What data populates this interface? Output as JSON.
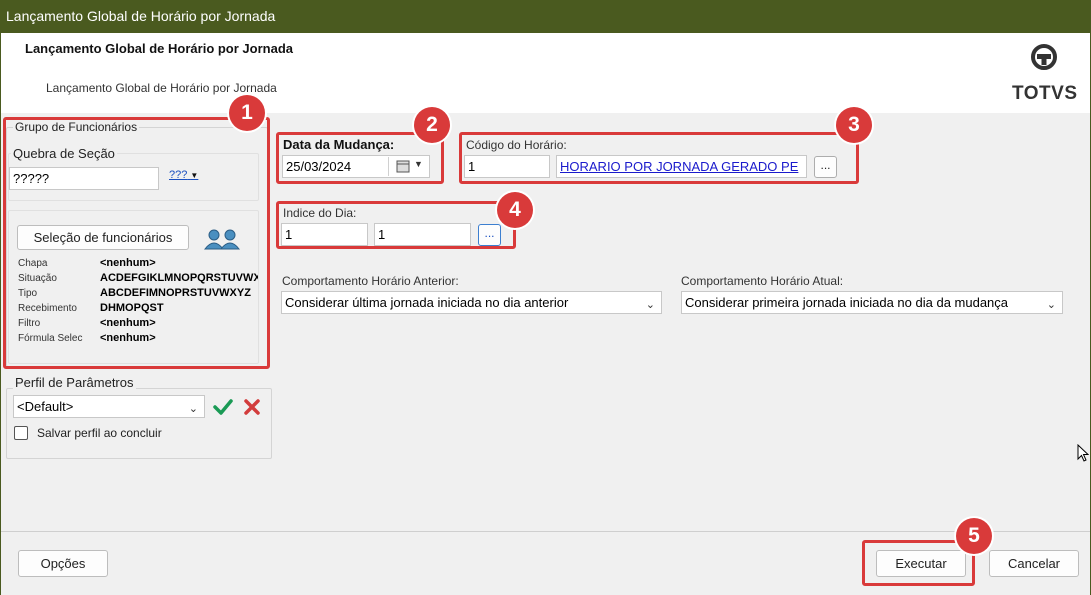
{
  "window": {
    "title": "Lançamento Global de Horário por Jornada"
  },
  "header": {
    "title": "Lançamento Global de Horário por Jornada",
    "subtitle": "Lançamento Global de Horário por Jornada",
    "logo_text": "TOTVS"
  },
  "grupo": {
    "legend": "Grupo de Funcionários",
    "quebra_label": "Quebra de Seção",
    "quebra_value": "?????",
    "quebra_button": "???",
    "selecao_button": "Seleção de funcionários",
    "info": [
      {
        "label": "Chapa",
        "value": "<nenhum>"
      },
      {
        "label": "Situação",
        "value": "ACDEFGIKLMNOPQRSTUVWXYZ"
      },
      {
        "label": "Tipo",
        "value": "ABCDEFIMNOPRSTUVWXYZ"
      },
      {
        "label": "Recebimento",
        "value": "DHMOPQST"
      },
      {
        "label": "Filtro",
        "value": "<nenhum>"
      },
      {
        "label": "Fórmula Selec",
        "value": "<nenhum>"
      }
    ]
  },
  "perfil": {
    "legend": "Perfil de Parâmetros",
    "value": "<Default>",
    "checkbox_label": "Salvar perfil ao concluir"
  },
  "data_mudanca": {
    "label": "Data da Mudança:",
    "value": "25/03/2024"
  },
  "codigo_horario": {
    "label": "Código do Horário:",
    "value": "1",
    "description": "HORARIO POR JORNADA GERADO PE",
    "lookup_button": "..."
  },
  "indice_dia": {
    "label": "Indice do Dia:",
    "value1": "1",
    "value2": "1",
    "lookup_button": "..."
  },
  "comportamento_anterior": {
    "label": "Comportamento Horário Anterior:",
    "value": "Considerar última jornada iniciada no dia anterior"
  },
  "comportamento_atual": {
    "label": "Comportamento Horário Atual:",
    "value": "Considerar primeira jornada iniciada no dia da mudança"
  },
  "footer": {
    "opcoes": "Opções",
    "executar": "Executar",
    "cancelar": "Cancelar"
  },
  "badges": [
    "1",
    "2",
    "3",
    "4",
    "5"
  ],
  "colors": {
    "titlebar": "#4a5a1f",
    "annotation": "#d93a3a",
    "link": "#1a1acc",
    "check": "#1a9a55",
    "cross": "#d23c3c"
  }
}
